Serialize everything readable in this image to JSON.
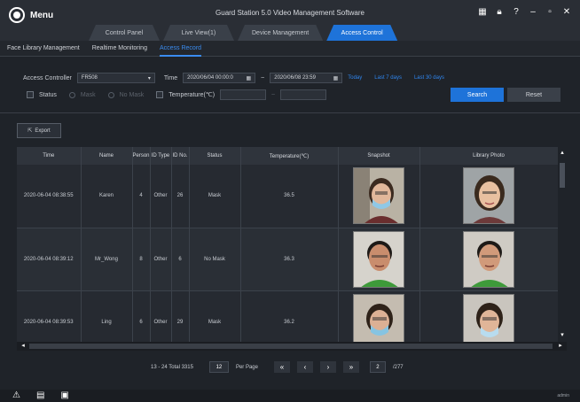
{
  "app": {
    "menu_label": "Menu",
    "title": "Guard Station 5.0 Video Management Software",
    "user": "admin"
  },
  "main_tabs": [
    {
      "label": "Control Panel"
    },
    {
      "label": "Live View(1)"
    },
    {
      "label": "Device Management"
    },
    {
      "label": "Access Control"
    }
  ],
  "sub_tabs": [
    {
      "label": "Face Library Management"
    },
    {
      "label": "Realtime Monitoring"
    },
    {
      "label": "Access Record"
    }
  ],
  "filters": {
    "controller_label": "Access Controller",
    "controller_value": "FR508",
    "time_label": "Time",
    "start_time": "2020/06/04 00:00:0",
    "end_time": "2020/06/08 23:59",
    "range_sep": "~",
    "today": "Today",
    "last7": "Last 7 days",
    "last30": "Last 30 days",
    "status_label": "Status",
    "mask_option": "Mask",
    "nomask_option": "No Mask",
    "temperature_label": "Temperature(℃)",
    "search": "Search",
    "reset": "Reset"
  },
  "export_label": "Export",
  "table": {
    "columns": [
      "Time",
      "Name",
      "Person ID",
      "ID Type",
      "ID No.",
      "Status",
      "Temperature(℃)",
      "Snapshot",
      "Library Photo"
    ],
    "rows": [
      {
        "time": "2020-06-04 08:38:55",
        "name": "Karen",
        "pid": "4",
        "idtype": "Other",
        "idno": "26",
        "status": "Mask",
        "temp": "36.5"
      },
      {
        "time": "2020-06-04 08:39:12",
        "name": "Mr_Wong",
        "pid": "8",
        "idtype": "Other",
        "idno": "6",
        "status": "No Mask",
        "temp": "36.3"
      },
      {
        "time": "2020-06-04 08:39:53",
        "name": "Ling",
        "pid": "6",
        "idtype": "Other",
        "idno": "29",
        "status": "Mask",
        "temp": "36.2"
      }
    ]
  },
  "pager": {
    "summary": "13 - 24 Total 3315",
    "per_page": "12",
    "per_page_label": "Per Page",
    "current": "2",
    "total": "/277"
  }
}
